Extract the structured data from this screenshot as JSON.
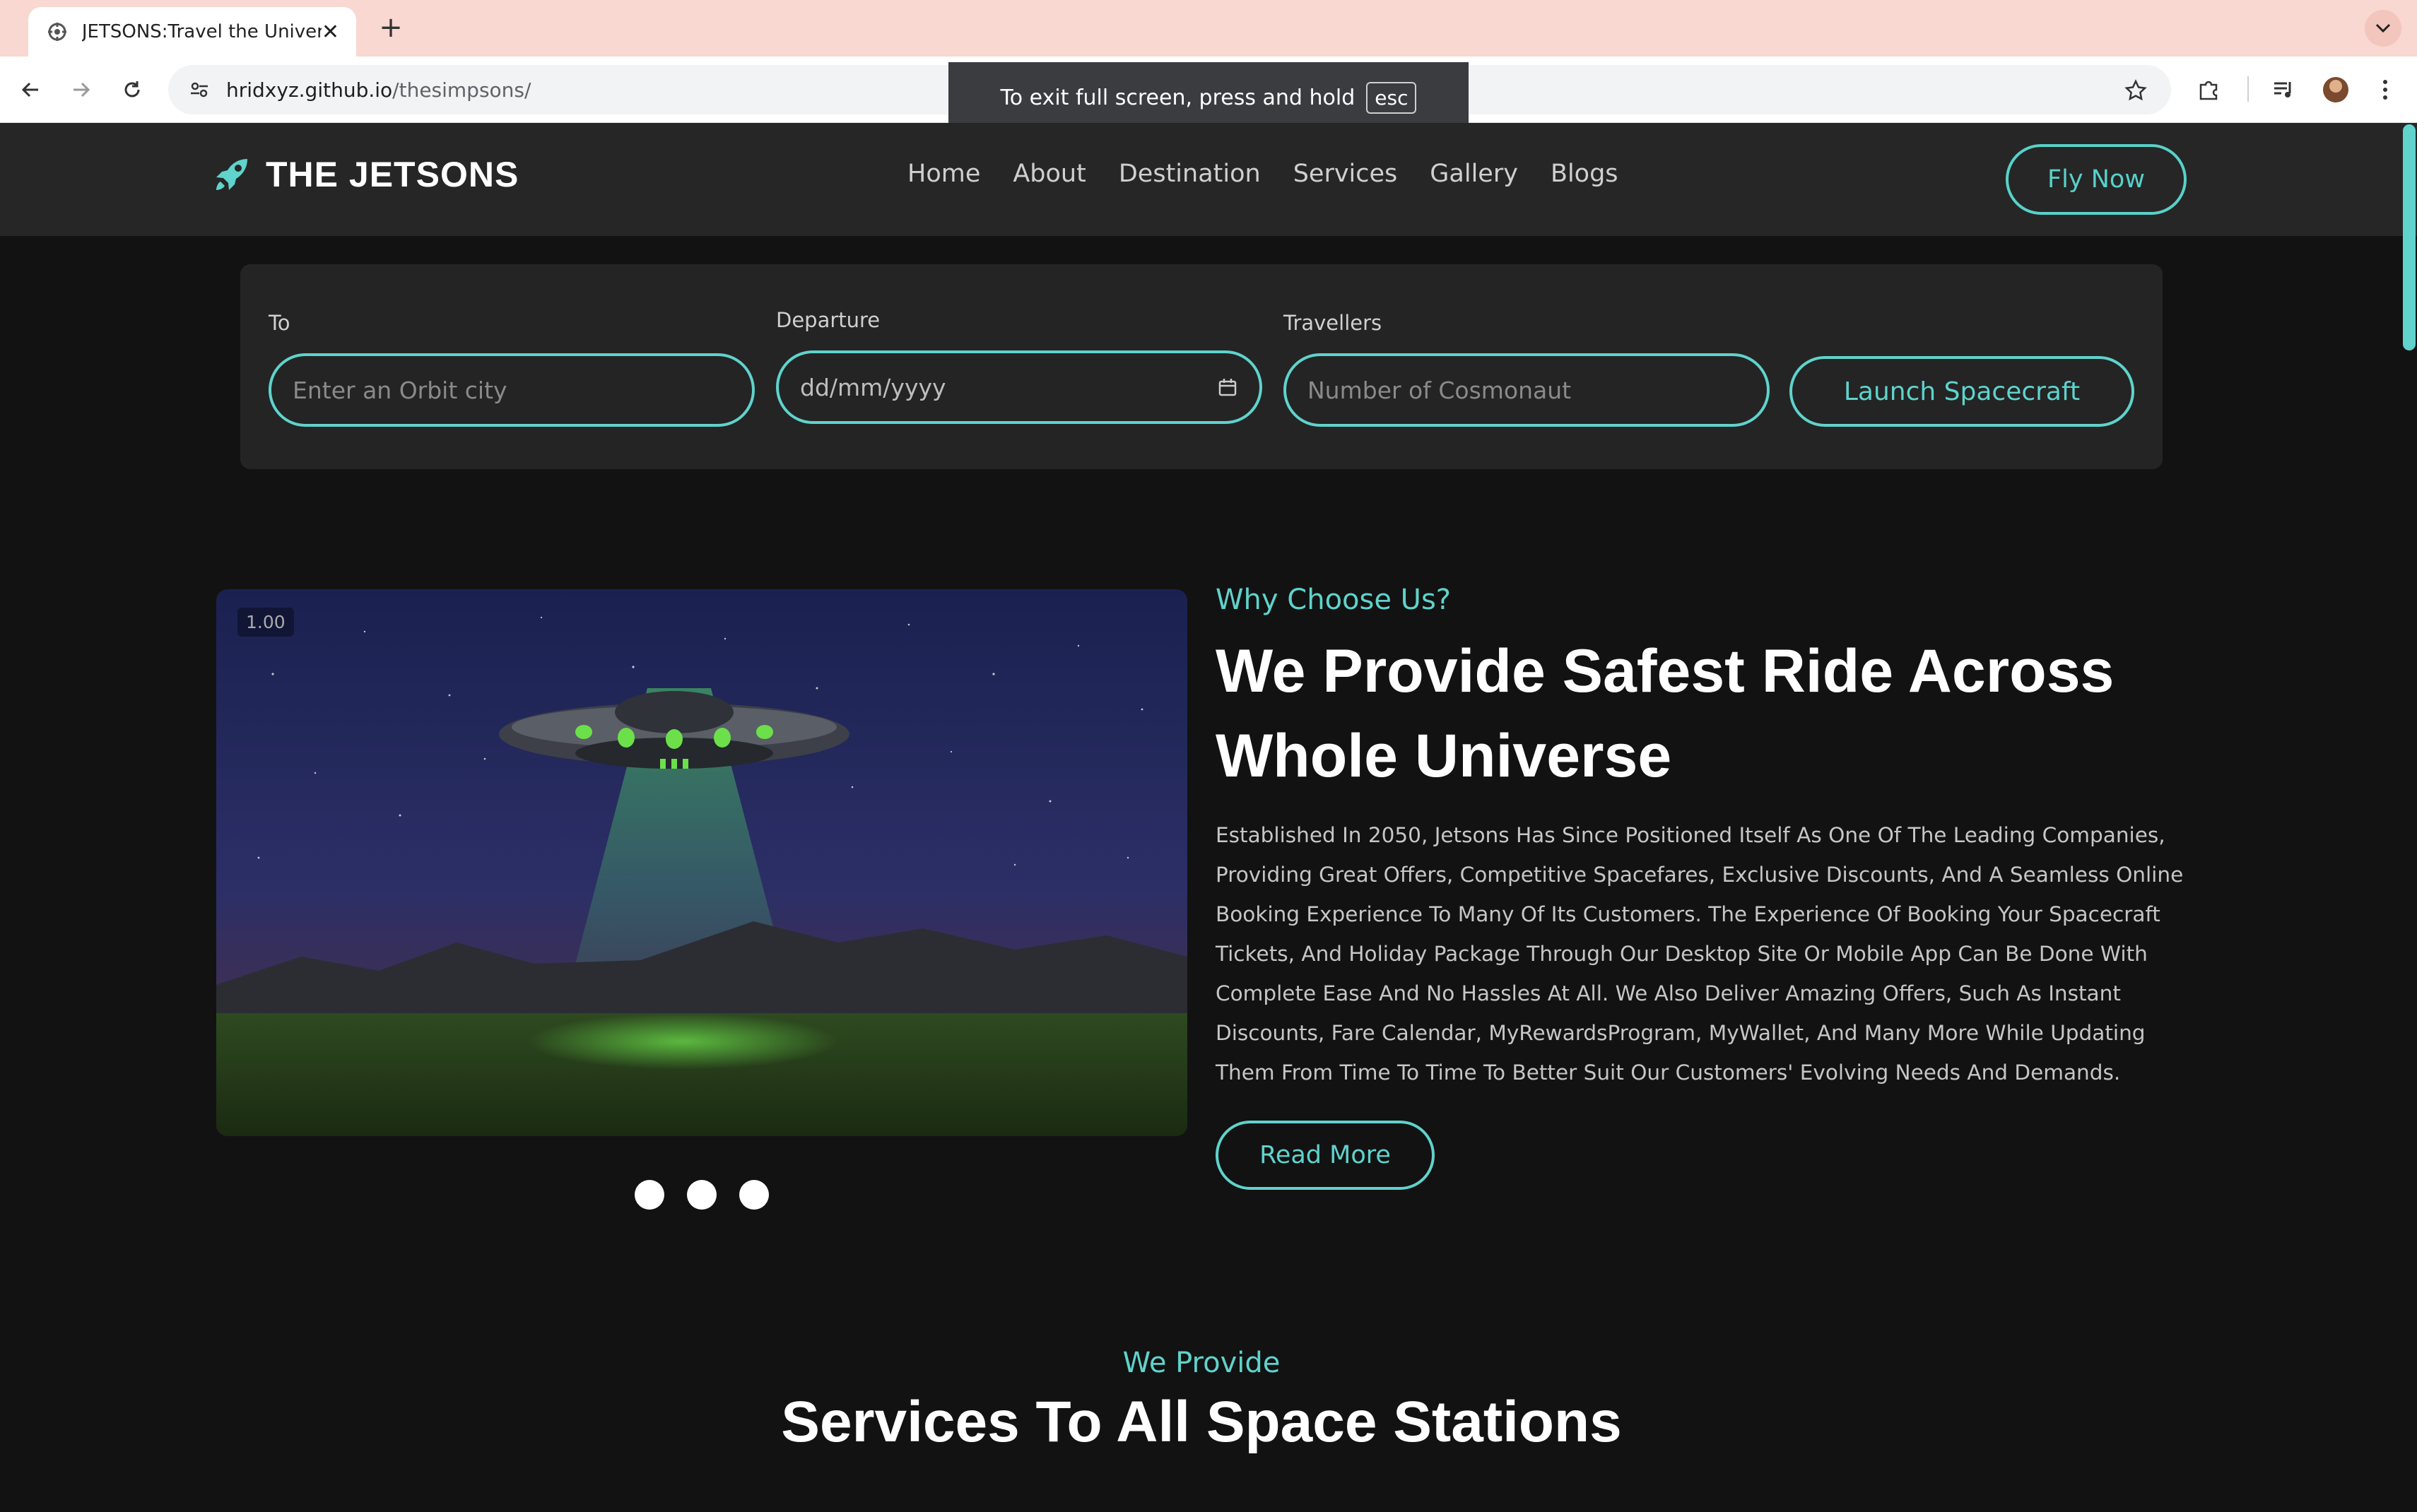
{
  "browser": {
    "tab_title": "JETSONS:Travel the Universe",
    "url_host": "hridxyz.github.io",
    "url_path": "/thesimpsons/",
    "fullscreen_toast": "To exit full screen, press and hold",
    "fullscreen_key": "esc"
  },
  "header": {
    "logo_text": "THE JETSONS",
    "nav": [
      "Home",
      "About",
      "Destination",
      "Services",
      "Gallery",
      "Blogs"
    ],
    "cta": "Fly Now"
  },
  "booking": {
    "to_label": "To",
    "to_placeholder": "Enter an Orbit city",
    "departure_label": "Departure",
    "departure_placeholder": "dd/mm/yyyy",
    "travellers_label": "Travellers",
    "travellers_placeholder": "Number of Cosmonaut",
    "submit": "Launch Spacecraft"
  },
  "hero": {
    "slide_badge": "1.00",
    "eyebrow": "Why Choose Us?",
    "title": "We Provide Safest Ride Across Whole Universe",
    "body": "Established In 2050, Jetsons Has Since Positioned Itself As One Of The Leading Companies, Providing Great Offers, Competitive Spacefares, Exclusive Discounts, And A Seamless Online Booking Experience To Many Of Its Customers. The Experience Of Booking Your Spacecraft Tickets, And Holiday Package Through Our Desktop Site Or Mobile App Can Be Done With Complete Ease And No Hassles At All. We Also Deliver Amazing Offers, Such As Instant Discounts, Fare Calendar, MyRewardsProgram, MyWallet, And Many More While Updating Them From Time To Time To Better Suit Our Customers' Evolving Needs And Demands.",
    "read_more": "Read More",
    "slide_count": 3
  },
  "services": {
    "eyebrow": "We Provide",
    "title": "Services To All Space Stations"
  },
  "colors": {
    "accent": "#5fd3cc",
    "page_bg": "#121212",
    "header_bg": "#262626",
    "tabbar_bg": "#f8d8d1"
  }
}
